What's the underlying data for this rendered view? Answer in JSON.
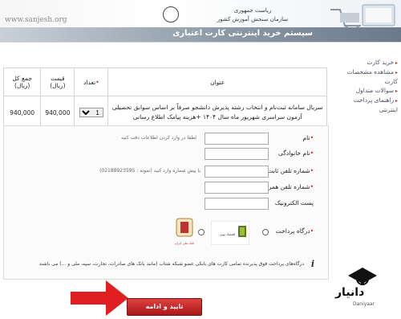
{
  "header": {
    "site_url": "www.sanjesh.org",
    "org_line1": "ریاست جمهوری",
    "org_line2": "سازمان سنجش آموزش کشور"
  },
  "page_title": "سیستم خرید اینترنتی کارت اعتباری",
  "sidebar": {
    "items": [
      {
        "label": "خرید کارت"
      },
      {
        "label": "مشاهده مشخصات کارت"
      },
      {
        "label": "سوالات متداول"
      },
      {
        "label": "راهنمای پرداخت اینترنتی"
      }
    ]
  },
  "product_table": {
    "headers": {
      "title": "عنوان",
      "count": "تعداد",
      "price": "قیمت (ریال)",
      "total": "جمع کل (ریال)"
    },
    "row": {
      "description": "سریال سامانه ثبت‌نام و انتخاب رشته پذیرش دانشجو صرفاً بر اساس سوابق تحصیلی آزمون سراسری شهریور ماه سال ۱۴۰۴ +هزینه پیامک اطلاع رسانی",
      "quantity": "1",
      "price": "940,000",
      "total": "940,000"
    }
  },
  "form": {
    "note": "لطفا در وارد کردن اطلاعات دقت کنید",
    "fields": {
      "first_name": "نام",
      "last_name": "نام خانوادگی",
      "phone": "شماره تلفن ثابت",
      "mobile": "شماره تلفن همراه",
      "email": "پست الکترونیک"
    },
    "phone_hint": "با پیش شماره وارد کنید (نمونه : 02188923595)",
    "gateway_label": "درگاه پرداخت",
    "gateways": [
      {
        "name": "بانک ملی ایران"
      },
      {
        "name": "اقتصاد نوین"
      }
    ],
    "info_text": "درگاه‌های پرداخت فوق پذیرنده تمامی کارت های بانکی عضو شبکه شتاب (مانند بانک های صادرات، تجارت، سپه، ملی و ...) می باشند",
    "submit_label": "تایید و ادامه"
  },
  "watermark": {
    "text": "دانیار",
    "sub": "Daniyaar"
  },
  "colors": {
    "title_bar": "#8e9aa8",
    "submit": "#c52a2a",
    "arrow": "#e02020",
    "required_star": "#dd2222"
  }
}
